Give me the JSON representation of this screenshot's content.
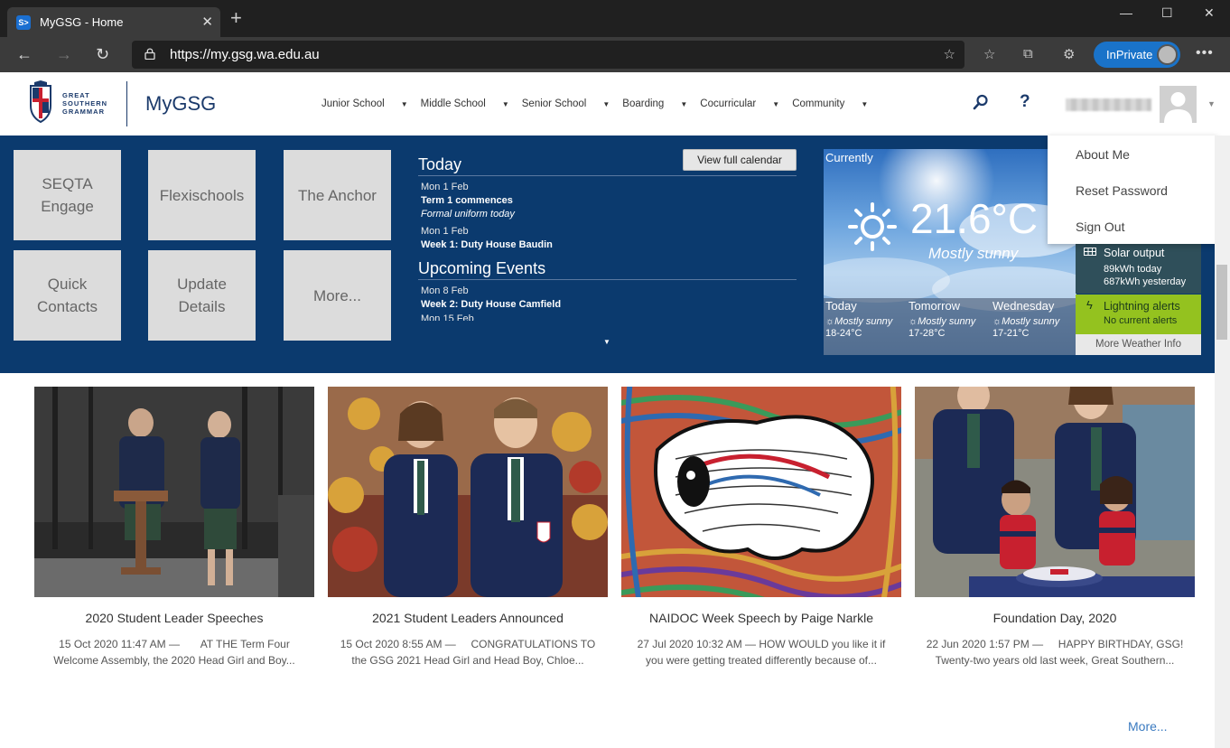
{
  "browser": {
    "tab_title": "MyGSG - Home",
    "tab_favicon_text": "S>",
    "url": "https://my.gsg.wa.edu.au",
    "inprivate_label": "InPrivate",
    "win_min": "—",
    "win_max": "☐",
    "win_close": "✕"
  },
  "header": {
    "logo_text_1": "GREAT",
    "logo_text_2": "SOUTHERN",
    "logo_text_3": "GRAMMAR",
    "site_title": "MyGSG",
    "nav": [
      "Junior School",
      "Middle School",
      "Senior School",
      "Boarding",
      "Cocurricular",
      "Community"
    ],
    "help": "?"
  },
  "user_menu": {
    "items": [
      "About Me",
      "Reset Password",
      "Sign Out"
    ]
  },
  "tiles": [
    {
      "label1": "SEQTA",
      "label2": "Engage"
    },
    {
      "label1": "Flexischools",
      "label2": ""
    },
    {
      "label1": "The Anchor",
      "label2": ""
    },
    {
      "label1": "Quick",
      "label2": "Contacts"
    },
    {
      "label1": "Update",
      "label2": "Details"
    },
    {
      "label1": "More...",
      "label2": ""
    }
  ],
  "calendar": {
    "button": "View full calendar",
    "today_heading": "Today",
    "today": [
      {
        "date": "Mon 1 Feb",
        "event": "Term 1 commences",
        "note": "Formal uniform today"
      },
      {
        "date": "Mon 1 Feb",
        "event": "Week 1: Duty House Baudin",
        "note": ""
      }
    ],
    "upcoming_heading": "Upcoming Events",
    "upcoming": [
      {
        "date": "Mon 8 Feb",
        "event": "Week 2: Duty House Camfield"
      },
      {
        "date": "Mon 15 Feb",
        "event": ""
      }
    ]
  },
  "weather": {
    "currently": "Currently",
    "temp": "21.6°C",
    "desc": "Mostly sunny",
    "forecast": [
      {
        "day": "Today",
        "summary": "Mostly sunny",
        "range": "18-24°C"
      },
      {
        "day": "Tomorrow",
        "summary": "Mostly sunny",
        "range": "17-28°C"
      },
      {
        "day": "Wednesday",
        "summary": "Mostly sunny",
        "range": "17-21°C"
      }
    ],
    "solar_title": "Solar output",
    "solar_today": "89kWh today",
    "solar_yesterday": "687kWh yesterday",
    "lightning_title": "Lightning alerts",
    "lightning_status": "No current alerts",
    "more_link": "More Weather Info"
  },
  "news": [
    {
      "title": "2020 Student Leader Speeches",
      "line1": "15 Oct 2020 11:47 AM —       AT THE Term Four",
      "line2": "Welcome Assembly, the 2020 Head Girl and Boy..."
    },
    {
      "title": "2021 Student Leaders Announced",
      "line1": "15 Oct 2020 8:55 AM —     CONGRATULATIONS TO",
      "line2": "the GSG 2021 Head Girl and Head Boy, Chloe..."
    },
    {
      "title": "NAIDOC Week Speech by Paige Narkle",
      "line1": "27 Jul 2020 10:32 AM — HOW WOULD you like it if",
      "line2": "you were getting treated differently because of..."
    },
    {
      "title": "Foundation Day, 2020",
      "line1": "22 Jun 2020 1:57 PM —     HAPPY BIRTHDAY, GSG!",
      "line2": "Twenty-two years old last week, Great Southern..."
    }
  ],
  "news_more": "More..."
}
